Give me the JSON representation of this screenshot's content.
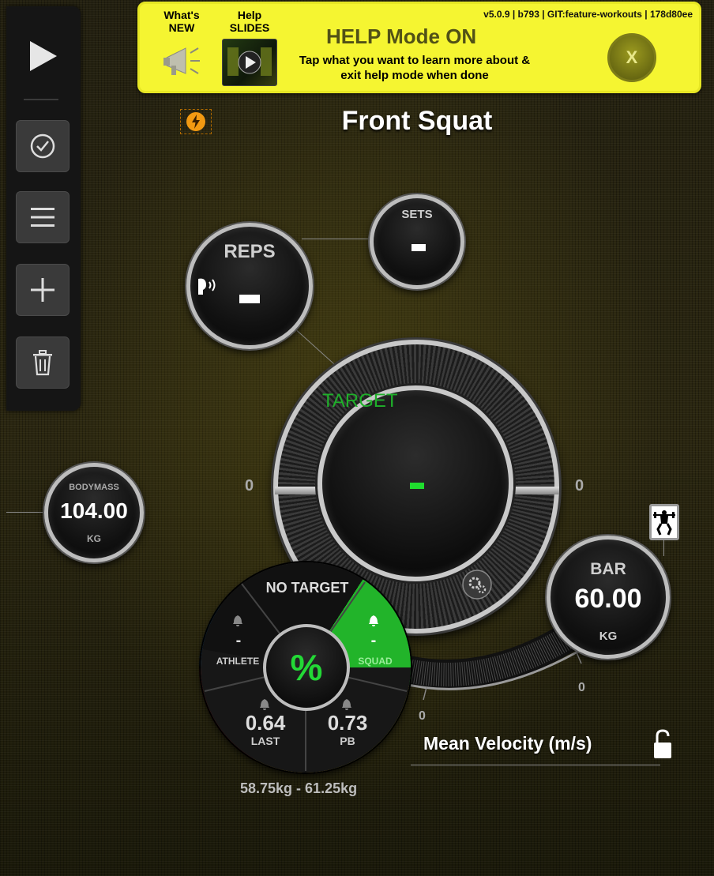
{
  "sidebar": {
    "play_icon": "play-icon",
    "buttons": [
      {
        "name": "check-button",
        "icon": "check-circle-icon"
      },
      {
        "name": "menu-button",
        "icon": "hamburger-menu-icon"
      },
      {
        "name": "add-button",
        "icon": "plus-icon"
      },
      {
        "name": "delete-button",
        "icon": "trash-icon"
      }
    ]
  },
  "help_banner": {
    "whats_new_label": "What's NEW",
    "help_slides_label": "Help SLIDES",
    "title": "HELP Mode ON",
    "subtitle": "Tap what you want to learn more about & exit help mode when done",
    "version": "v5.0.9 | b793 | GIT:feature-workouts | 178d80ee",
    "close_label": "X",
    "background_color": "#f5f531"
  },
  "exercise": {
    "title": "Front Squat"
  },
  "reps": {
    "label": "REPS",
    "value": "-"
  },
  "sets": {
    "label": "SETS",
    "value": "-"
  },
  "bodymass": {
    "label": "BODYMASS",
    "value": "104.00",
    "unit": "KG"
  },
  "target": {
    "label": "TARGET",
    "value": "-",
    "left_zero": "0",
    "right_zero": "0",
    "accent_color": "#1fb02a"
  },
  "bar": {
    "label": "BAR",
    "value": "60.00",
    "unit": "KG"
  },
  "percent_wheel": {
    "center": "%",
    "no_target": "NO TARGET",
    "athlete": {
      "label": "ATHLETE",
      "value": "-"
    },
    "squad": {
      "label": "SQUAD",
      "value": "-"
    },
    "last": {
      "label": "LAST",
      "value": "0.64"
    },
    "pb": {
      "label": "PB",
      "value": "0.73"
    }
  },
  "velocity_axis": {
    "zero_a": "0",
    "zero_b": "0",
    "label": "Mean Velocity (m/s)"
  },
  "range": "58.75kg - 61.25kg"
}
